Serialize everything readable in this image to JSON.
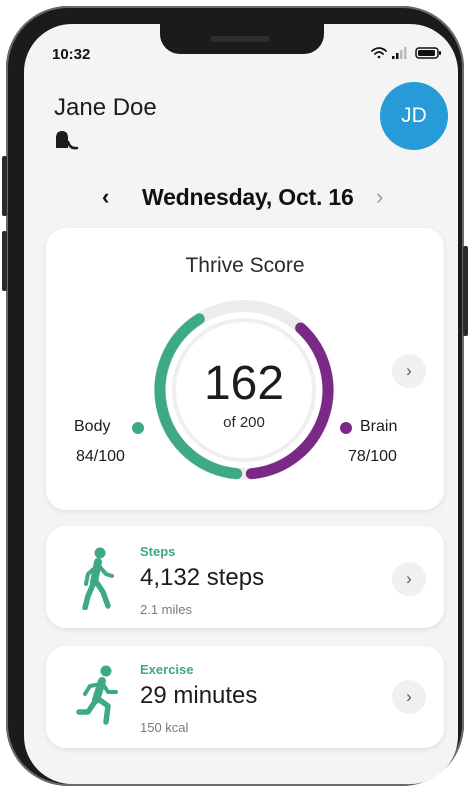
{
  "status": {
    "time": "10:32"
  },
  "user": {
    "name": "Jane Doe",
    "initials": "JD"
  },
  "date_nav": {
    "prev": "‹",
    "date": "Wednesday, Oct. 16",
    "next": "›"
  },
  "thrive": {
    "title": "Thrive Score",
    "score": "162",
    "of": "of 200",
    "body_label": "Body",
    "body_value": "84/100",
    "brain_label": "Brain",
    "brain_value": "78/100",
    "body_fraction": 0.84,
    "brain_fraction": 0.78,
    "chevron": "›"
  },
  "steps": {
    "kicker": "Steps",
    "value": "4,132 steps",
    "sub": "2.1 miles",
    "chevron": "›"
  },
  "exercise": {
    "kicker": "Exercise",
    "value": "29 minutes",
    "sub": "150 kcal",
    "chevron": "›"
  },
  "colors": {
    "body": "#3daa85",
    "brain": "#7a2a86",
    "avatar": "#279bd8",
    "ring_bg": "#e9e9ec"
  },
  "icons": {
    "logo": "hearing-aid-icon",
    "back": "chevron-left-icon",
    "forward": "chevron-right-icon",
    "steps": "walking-person-icon",
    "exercise": "running-person-icon"
  }
}
